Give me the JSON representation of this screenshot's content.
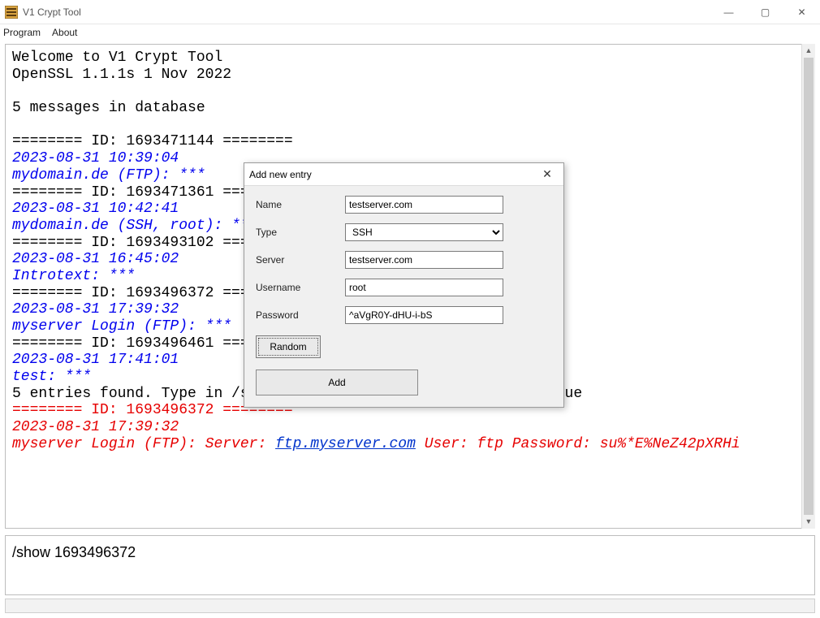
{
  "window": {
    "title": "V1 Crypt Tool",
    "menu": {
      "program": "Program",
      "about": "About"
    },
    "controls": {
      "min": "—",
      "max": "▢",
      "close": "✕"
    }
  },
  "output": {
    "welcome_line": "Welcome to V1 Crypt Tool",
    "openssl_line": "OpenSSL 1.1.1s  1 Nov 2022",
    "db_count_line": "5 messages in database",
    "sep": "========",
    "id_label": "ID:",
    "entries": [
      {
        "id": "1693471144",
        "ts": "2023-08-31 10:39:04",
        "label": "mydomain.de (FTP): ***"
      },
      {
        "id": "1693471361",
        "ts": "2023-08-31 10:42:41",
        "label": "mydomain.de (SSH, root): ***"
      },
      {
        "id": "1693493102",
        "ts": "2023-08-31 16:45:02",
        "label": "Introtext: ***"
      },
      {
        "id": "1693496372",
        "ts": "2023-08-31 17:39:32",
        "label": "myserver Login (FTP): ***"
      },
      {
        "id": "1693496461",
        "ts": "2023-08-31 17:41:01",
        "label": "test: ***"
      }
    ],
    "summary_line": "5 entries found. Type in /show <id or index> to show secure value",
    "show": {
      "id": "1693496372",
      "ts": "2023-08-31 17:39:32",
      "prefix": "myserver Login (FTP): Server: ",
      "link": "ftp.myserver.com",
      "suffix": " User: ftp Password: su%*E%NeZ42pXRHi"
    }
  },
  "command_input": "/show 1693496372",
  "dialog": {
    "title": "Add new entry",
    "labels": {
      "name": "Name",
      "type": "Type",
      "server": "Server",
      "username": "Username",
      "password": "Password"
    },
    "values": {
      "name": "testserver.com",
      "type": "SSH",
      "server": "testserver.com",
      "username": "root",
      "password": "^aVgR0Y-dHU-i-bS"
    },
    "type_options": [
      "SSH"
    ],
    "random_label": "Random",
    "add_label": "Add"
  }
}
